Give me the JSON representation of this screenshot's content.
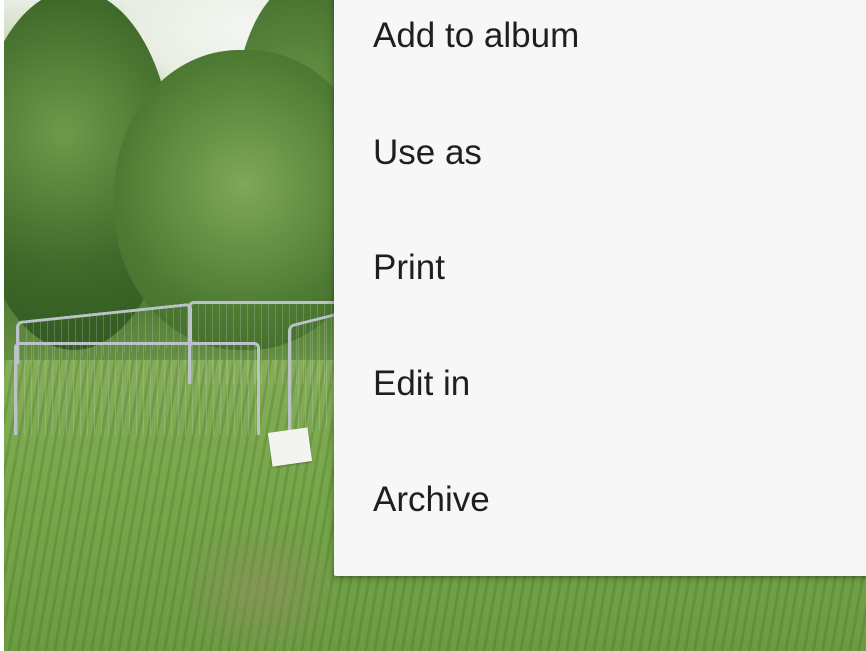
{
  "menu": {
    "items": [
      {
        "label": "Add to album"
      },
      {
        "label": "Use as"
      },
      {
        "label": "Print"
      },
      {
        "label": "Edit in"
      },
      {
        "label": "Archive"
      }
    ]
  },
  "colors": {
    "menu_background": "#f7f7f7",
    "menu_text": "#1f1f1f"
  }
}
